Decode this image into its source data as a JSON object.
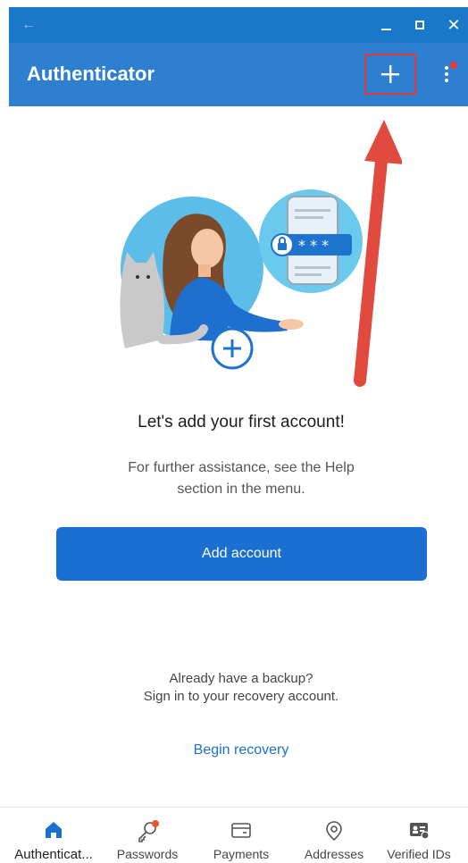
{
  "window": {
    "back_icon": "back-arrow-icon",
    "minimize_icon": "minimize-icon",
    "maximize_icon": "maximize-icon",
    "close_icon": "close-icon"
  },
  "appbar": {
    "title": "Authenticator",
    "add_icon": "plus-icon",
    "more_icon": "more-vertical-icon",
    "notification_color": "#e53935"
  },
  "empty_state": {
    "heading": "Let's add your first account!",
    "help_text": "For further assistance, see the Help section in the menu.",
    "add_account_label": "Add account",
    "backup_line1": "Already have a backup?",
    "backup_line2": "Sign in to your recovery account.",
    "recovery_link": "Begin recovery",
    "illustration_code": "* * *"
  },
  "bottom_nav": {
    "items": [
      {
        "label": "Authenticat...",
        "icon": "home-icon",
        "active": true
      },
      {
        "label": "Passwords",
        "icon": "key-icon",
        "badge": true
      },
      {
        "label": "Payments",
        "icon": "card-icon"
      },
      {
        "label": "Addresses",
        "icon": "location-icon"
      },
      {
        "label": "Verified IDs",
        "icon": "id-card-icon"
      }
    ]
  },
  "colors": {
    "titlebar": "#1a78c8",
    "appbar": "#2f7fd0",
    "primary": "#1a6fd1",
    "annotation": "#e53935"
  }
}
